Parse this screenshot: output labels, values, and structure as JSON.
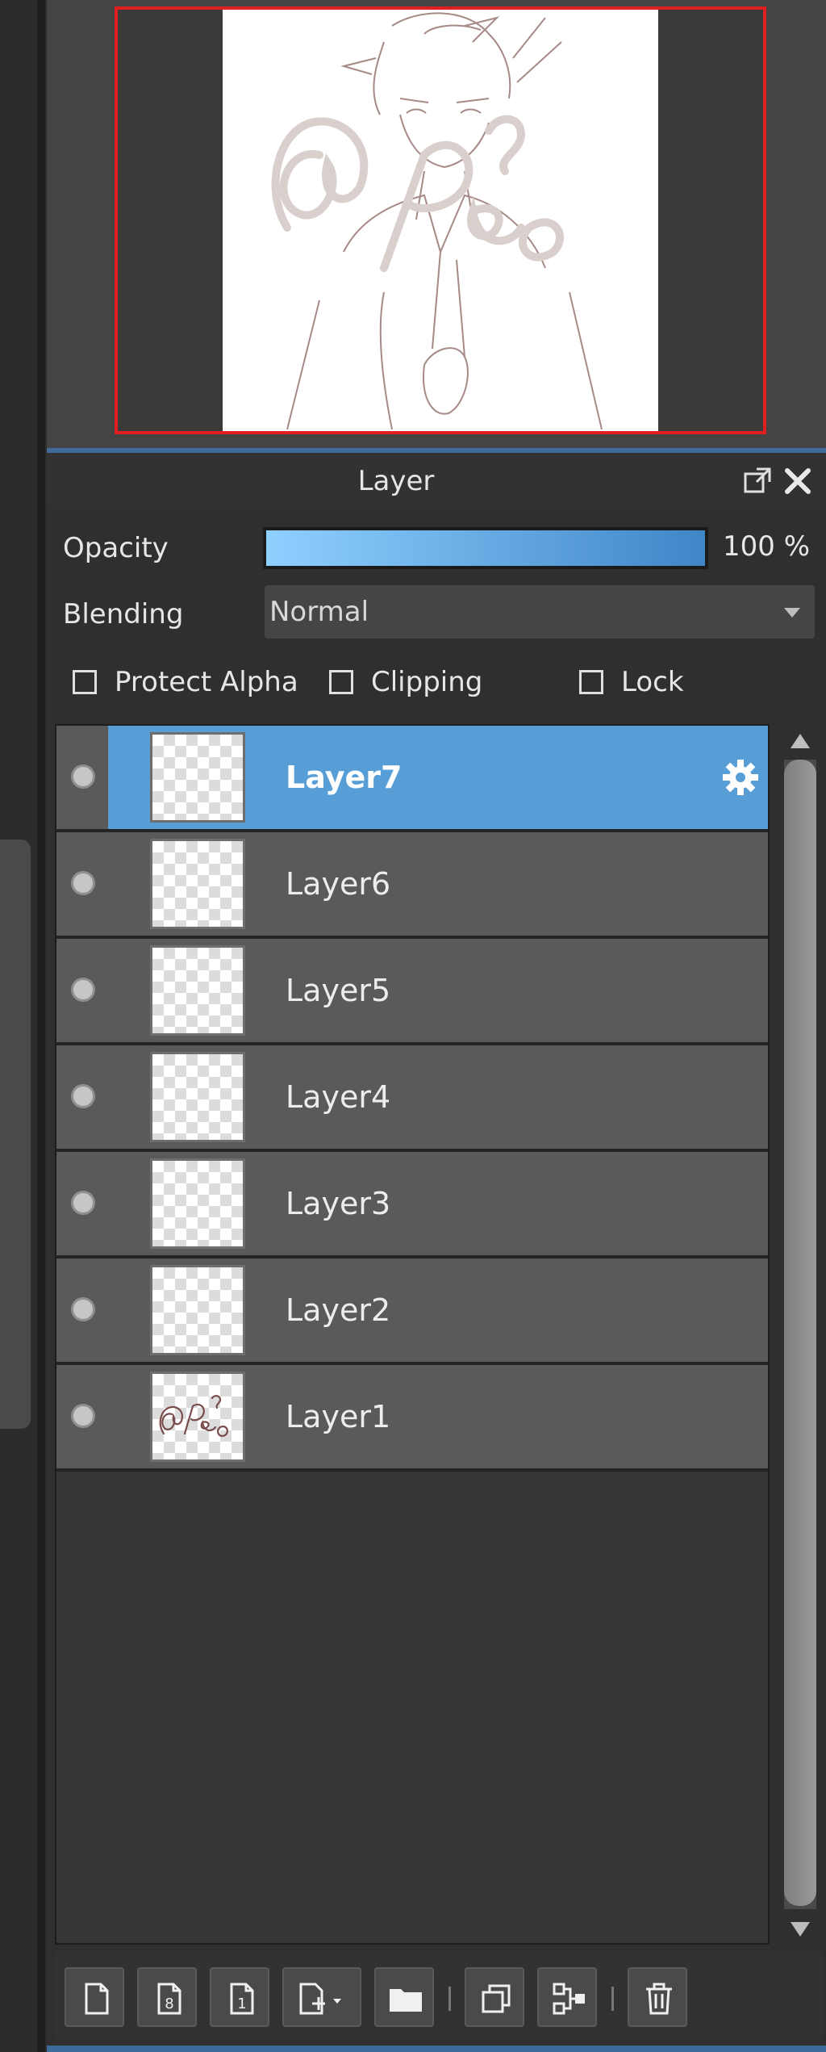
{
  "panel": {
    "title": "Layer",
    "opacity_label": "Opacity",
    "opacity_value": "100 %",
    "opacity_fraction": 1.0,
    "blending_label": "Blending",
    "blending_value": "Normal",
    "checkboxes": {
      "protect_alpha": "Protect Alpha",
      "clipping": "Clipping",
      "lock": "Lock"
    }
  },
  "layers": [
    {
      "name": "Layer7",
      "selected": true
    },
    {
      "name": "Layer6",
      "selected": false
    },
    {
      "name": "Layer5",
      "selected": false
    },
    {
      "name": "Layer4",
      "selected": false
    },
    {
      "name": "Layer3",
      "selected": false
    },
    {
      "name": "Layer2",
      "selected": false
    },
    {
      "name": "Layer1",
      "selected": false
    }
  ],
  "navigator": {
    "preview_watermark": "@Peo"
  },
  "layer1_thumb_text": "@Peo",
  "colors": {
    "selection": "#579ed6",
    "navigator_frame": "#e02020",
    "accent_line": "#3e6b99"
  },
  "toolbar_icons": [
    "new-layer-icon",
    "new-8bit-layer-icon",
    "new-1bit-layer-icon",
    "add-layer-menu-icon",
    "new-folder-icon",
    "duplicate-layer-icon",
    "merge-layer-icon",
    "delete-layer-icon"
  ]
}
